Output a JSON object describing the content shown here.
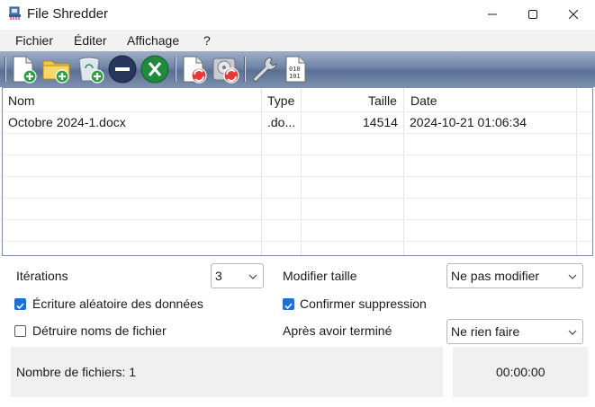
{
  "window": {
    "title": "File Shredder",
    "icon": "file-shredder-app-icon",
    "controls": [
      "minimize-icon",
      "maximize-icon",
      "close-icon"
    ]
  },
  "menu": {
    "items": [
      "Fichier",
      "Éditer",
      "Affichage",
      "?"
    ]
  },
  "toolbar": {
    "buttons": [
      {
        "name": "add-file-icon"
      },
      {
        "name": "add-folder-icon"
      },
      {
        "name": "add-recycle-bin-icon"
      },
      {
        "name": "remove-icon"
      },
      {
        "name": "clear-list-icon"
      },
      {
        "name": "shred-files-icon"
      },
      {
        "name": "shred-free-space-icon"
      },
      {
        "name": "settings-wrench-icon"
      },
      {
        "name": "binary-file-icon"
      }
    ]
  },
  "filelist": {
    "columns": [
      "Nom",
      "Type",
      "Taille",
      "Date"
    ],
    "rows": [
      {
        "name": "Octobre 2024-1.docx",
        "type": ".do...",
        "size": "14514",
        "date": "2024-10-21 01:06:34"
      }
    ]
  },
  "settings": {
    "iterations_label": "Itérations",
    "iterations_value": "3",
    "modify_size_label": "Modifier taille",
    "modify_size_value": "Ne pas modifier",
    "random_write_label": "Écriture aléatoire des données",
    "random_write_checked": true,
    "confirm_delete_label": "Confirmer suppression",
    "confirm_delete_checked": true,
    "destroy_names_label": "Détruire noms de fichier",
    "destroy_names_checked": false,
    "after_finish_label": "Après avoir terminé",
    "after_finish_value": "Ne rien faire"
  },
  "status": {
    "file_count": "Nombre de fichiers: 1",
    "timer": "00:00:00"
  },
  "colors": {
    "toolbar_top": "#9fb0c8",
    "toolbar_bottom": "#5a6f92",
    "checkbox_accent": "#1f6fd1"
  }
}
